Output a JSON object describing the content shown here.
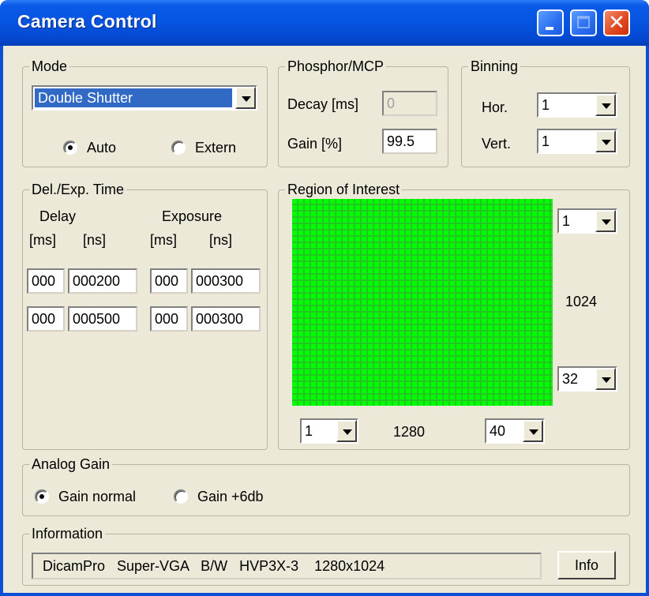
{
  "window": {
    "title": "Camera Control"
  },
  "mode": {
    "legend": "Mode",
    "selected": "Double Shutter",
    "radios": [
      {
        "label": "Auto",
        "checked": true
      },
      {
        "label": "Extern",
        "checked": false
      }
    ]
  },
  "phosphor": {
    "legend": "Phosphor/MCP",
    "decay_label": "Decay [ms]",
    "decay_value": "0",
    "gain_label": "Gain  [%]",
    "gain_value": "99.5"
  },
  "binning": {
    "legend": "Binning",
    "hor_label": "Hor.",
    "hor_value": "1",
    "vert_label": "Vert.",
    "vert_value": "1"
  },
  "timing": {
    "legend": "Del./Exp. Time",
    "delay_header": "Delay",
    "exposure_header": "Exposure",
    "unit_ms": "[ms]",
    "unit_ns": "[ns]",
    "rows": [
      {
        "delay_ms": "000",
        "delay_ns": "000200",
        "exp_ms": "000",
        "exp_ns": "000300"
      },
      {
        "delay_ms": "000",
        "delay_ns": "000500",
        "exp_ms": "000",
        "exp_ns": "000300"
      }
    ]
  },
  "roi": {
    "legend": "Region of Interest",
    "top_value": "1",
    "height_label": "1024",
    "bottom_value": "32",
    "left_value": "1",
    "width_label": "1280",
    "right_value": "40",
    "grid_color": "#00ff00"
  },
  "analog_gain": {
    "legend": "Analog Gain",
    "options": [
      {
        "label": "Gain normal",
        "checked": true
      },
      {
        "label": "Gain +6db",
        "checked": false
      }
    ]
  },
  "information": {
    "legend": "Information",
    "text": "DicamPro   Super-VGA   B/W   HVP3X-3    1280x1024",
    "info_button": "Info"
  }
}
